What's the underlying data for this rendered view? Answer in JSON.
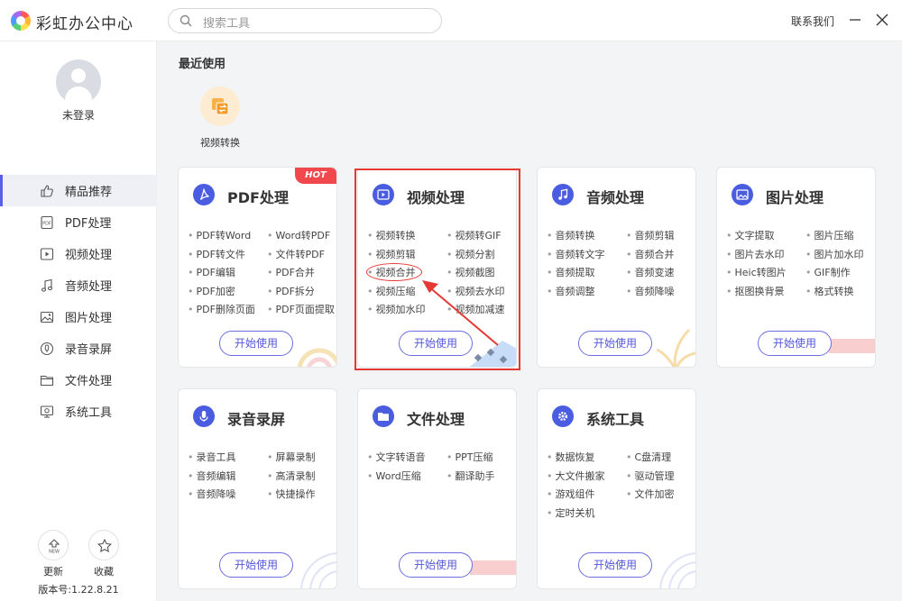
{
  "app": {
    "title": "彩虹办公中心"
  },
  "search": {
    "placeholder": "搜索工具"
  },
  "header": {
    "contact": "联系我们"
  },
  "user": {
    "status": "未登录"
  },
  "sidebar": {
    "items": [
      {
        "label": "精品推荐",
        "icon": "thumbs-up-icon",
        "active": true
      },
      {
        "label": "PDF处理",
        "icon": "pdf-icon"
      },
      {
        "label": "视频处理",
        "icon": "video-icon"
      },
      {
        "label": "音频处理",
        "icon": "music-icon"
      },
      {
        "label": "图片处理",
        "icon": "image-icon"
      },
      {
        "label": "录音录屏",
        "icon": "record-icon"
      },
      {
        "label": "文件处理",
        "icon": "folder-icon"
      },
      {
        "label": "系统工具",
        "icon": "monitor-icon"
      }
    ],
    "update_label": "更新",
    "favorite_label": "收藏",
    "version": "版本号:1.22.8.21"
  },
  "recent": {
    "title": "最近使用",
    "items": [
      {
        "label": "视频转换",
        "icon": "video-convert-icon"
      }
    ]
  },
  "cards": [
    {
      "title": "PDF处理",
      "icon": "pdf-icon",
      "color": "#4a5ce0",
      "badge": "HOT",
      "items": [
        "PDF转Word",
        "Word转PDF",
        "PDF转文件",
        "文件转PDF",
        "PDF编辑",
        "PDF合并",
        "PDF加密",
        "PDF拆分",
        "PDF删除页面",
        "PDF页面提取"
      ],
      "button": "开始使用"
    },
    {
      "title": "视频处理",
      "icon": "video-icon",
      "color": "#4a5ce0",
      "items": [
        "视频转换",
        "视频转GIF",
        "视频剪辑",
        "视频分割",
        "视频合并",
        "视频截图",
        "视频压缩",
        "视频去水印",
        "视频加水印",
        "视频加减速"
      ],
      "button": "开始使用"
    },
    {
      "title": "音频处理",
      "icon": "music-icon",
      "color": "#4a5ce0",
      "items": [
        "音频转换",
        "音频剪辑",
        "音频转文字",
        "音频合并",
        "音频提取",
        "音频变速",
        "音频调整",
        "音频降噪"
      ],
      "button": "开始使用"
    },
    {
      "title": "图片处理",
      "icon": "image-icon",
      "color": "#4a5ce0",
      "items": [
        "文字提取",
        "图片压缩",
        "图片去水印",
        "图片加水印",
        "Heic转图片",
        "GIF制作",
        "抠图换背景",
        "格式转换"
      ],
      "button": "开始使用"
    },
    {
      "title": "录音录屏",
      "icon": "microphone-icon",
      "color": "#4a5ce0",
      "items": [
        "录音工具",
        "屏幕录制",
        "音频编辑",
        "高清录制",
        "音频降噪",
        "快捷操作"
      ],
      "button": "开始使用"
    },
    {
      "title": "文件处理",
      "icon": "folder-icon",
      "color": "#4a5ce0",
      "items": [
        "文字转语音",
        "PPT压缩",
        "Word压缩",
        "翻译助手"
      ],
      "button": "开始使用"
    },
    {
      "title": "系统工具",
      "icon": "gear-icon",
      "color": "#4a5ce0",
      "items": [
        "数据恢复",
        "C盘清理",
        "大文件搬家",
        "驱动管理",
        "游戏组件",
        "文件加密",
        "定时关机"
      ],
      "button": "开始使用"
    }
  ]
}
